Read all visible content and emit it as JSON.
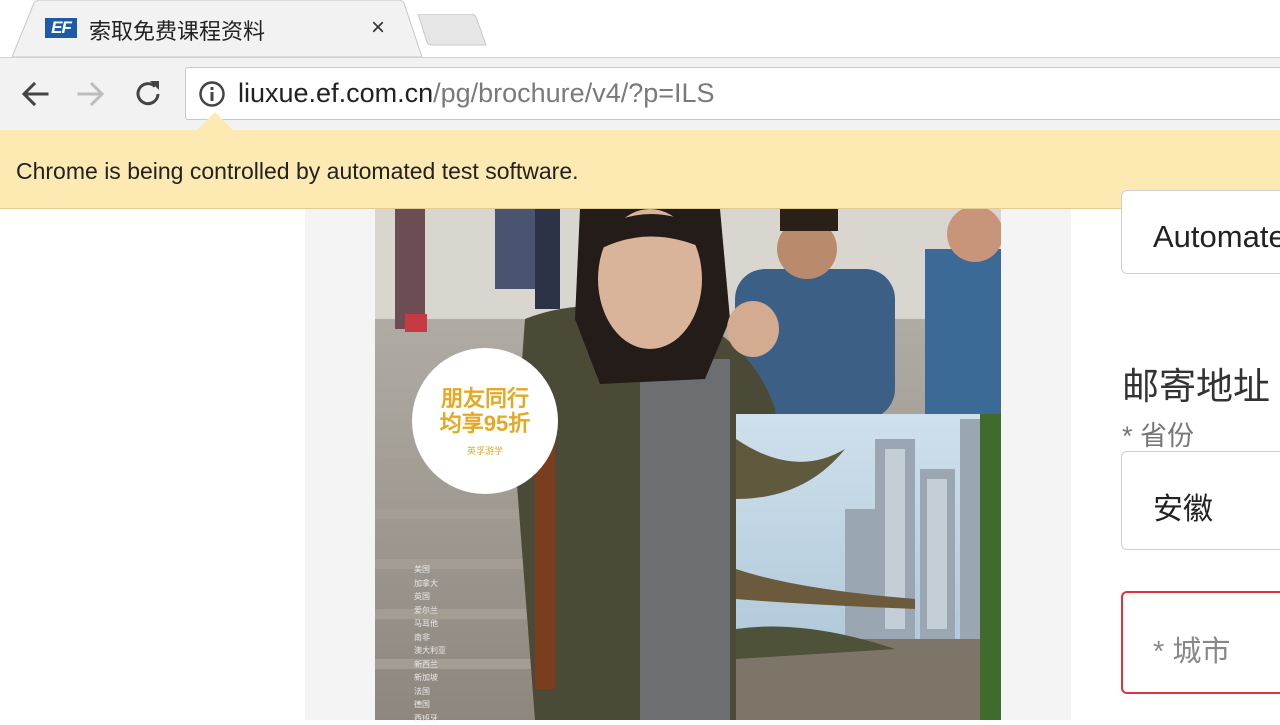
{
  "browser": {
    "tab": {
      "title": "索取免费课程资料",
      "favicon_text": "EF",
      "close_glyph": "×"
    },
    "address": {
      "host": "liuxue.ef.com.cn",
      "path": "/pg/brochure/v4/?p=ILS"
    },
    "infobar_text": "Chrome is being controlled by automated test software."
  },
  "brochure": {
    "badge_line1": "朋友同行",
    "badge_line2": "均享95折",
    "badge_small": "英孚游学",
    "countries": [
      "美国",
      "加拿大",
      "英国",
      "爱尔兰",
      "马耳他",
      "南非",
      "澳大利亚",
      "新西兰",
      "新加坡",
      "法国",
      "德国",
      "西班牙"
    ]
  },
  "form": {
    "top_field_value": "Automate",
    "section_title": "邮寄地址",
    "province_label": "* 省份",
    "province_value": "安徽",
    "city_placeholder": "* 城市"
  },
  "colors": {
    "infobar_bg": "#fde9b2",
    "badge_text": "#e5a823",
    "error_border": "#e0333c",
    "ef_blue": "#1d5aa8"
  }
}
